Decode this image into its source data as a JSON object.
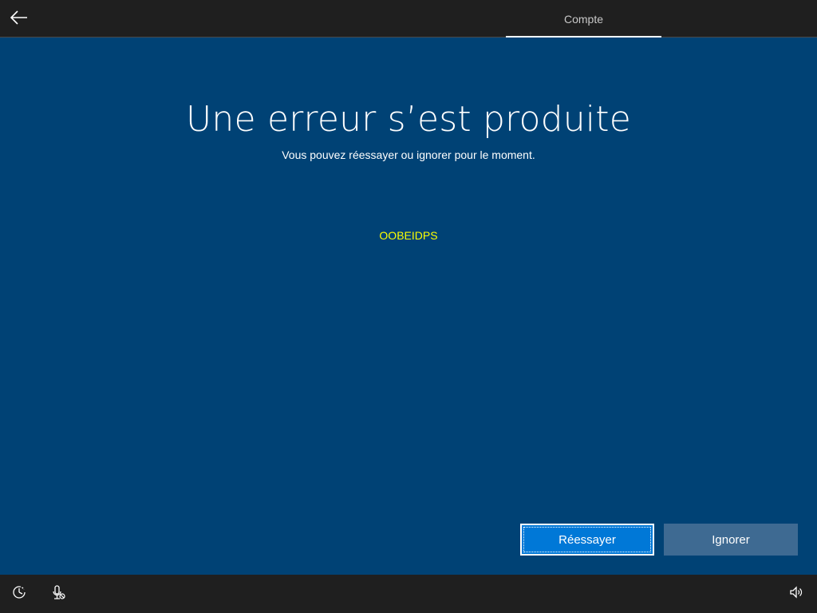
{
  "header": {
    "tab_label": "Compte"
  },
  "main": {
    "title": "Une erreur s’est produite",
    "subtitle": "Vous pouvez réessayer ou ignorer pour le moment.",
    "error_code": "OOBEIDPS"
  },
  "actions": {
    "retry_label": "Réessayer",
    "skip_label": "Ignorer"
  },
  "colors": {
    "background": "#004275",
    "bar": "#1f1f1f",
    "primary_button": "#0078d7",
    "secondary_button": "#3e6a92",
    "error_code": "#ffff00"
  },
  "icons": {
    "back": "back-arrow-icon",
    "ease_of_access": "ease-of-access-icon",
    "microphone": "microphone-muted-icon",
    "volume": "volume-icon"
  }
}
